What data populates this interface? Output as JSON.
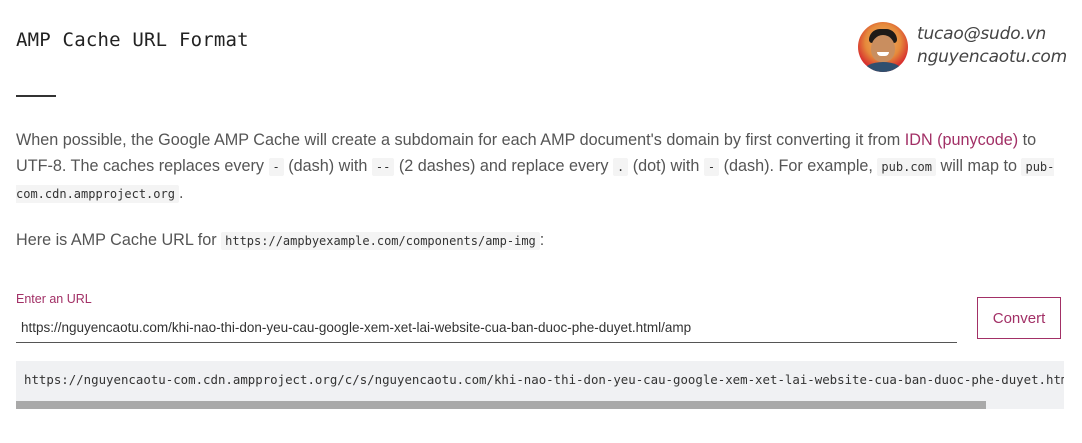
{
  "header": {
    "title": "AMP Cache URL Format"
  },
  "author": {
    "email": "tucao@sudo.vn",
    "site": "nguyencaotu.com"
  },
  "intro": {
    "part1": "When possible, the Google AMP Cache will create a subdomain for each AMP document's domain by first converting it from ",
    "link": "IDN (punycode)",
    "part2": " to UTF-8. The caches replaces every ",
    "code_dash": "-",
    "part3": " (dash) with ",
    "code_double_dash": "--",
    "part4": " (2 dashes) and replace every ",
    "code_dot": ".",
    "part5": " (dot) with ",
    "code_dash2": "-",
    "part6": " (dash). For example, ",
    "code_example_domain": "pub.com",
    "part7": " will map to ",
    "code_example_cache": "pub-com.cdn.ampproject.org",
    "part8": "."
  },
  "example": {
    "prefix": "Here is AMP Cache URL for ",
    "code_url": "https://ampbyexample.com/components/amp-img",
    "suffix": ":"
  },
  "form": {
    "label": "Enter an URL",
    "input_value": "https://nguyencaotu.com/khi-nao-thi-don-yeu-cau-google-xem-xet-lai-website-cua-ban-duoc-phe-duyet.html/amp",
    "button_label": "Convert"
  },
  "result": {
    "text": "https://nguyencaotu-com.cdn.ampproject.org/c/s/nguyencaotu.com/khi-nao-thi-don-yeu-cau-google-xem-xet-lai-website-cua-ban-duoc-phe-duyet.html/amp"
  },
  "colors": {
    "accent": "#a23066",
    "text": "#555555",
    "code_background": "#f0f1f3"
  },
  "icons": {
    "avatar": "author-avatar-photo"
  }
}
